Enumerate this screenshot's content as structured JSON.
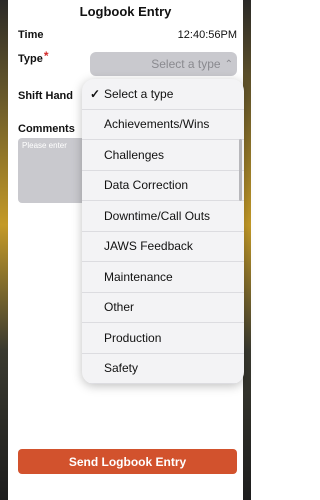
{
  "header": {
    "title": "Logbook Entry"
  },
  "form": {
    "time_label": "Time",
    "time_value": "12:40:56PM",
    "type_label": "Type",
    "required_mark": "*",
    "type_placeholder": "Select a type",
    "shift_label": "Shift Hand",
    "comments_label": "Comments",
    "comments_placeholder": "Please enter"
  },
  "dropdown": {
    "items": [
      "Select a type",
      "Achievements/Wins",
      "Challenges",
      "Data Correction",
      "Downtime/Call Outs",
      "JAWS Feedback",
      "Maintenance",
      "Other",
      "Production",
      "Safety"
    ],
    "selected_check": "✓"
  },
  "actions": {
    "send_label": "Send Logbook Entry"
  },
  "colors": {
    "accent": "#d2522d",
    "required": "#d22b2b"
  }
}
